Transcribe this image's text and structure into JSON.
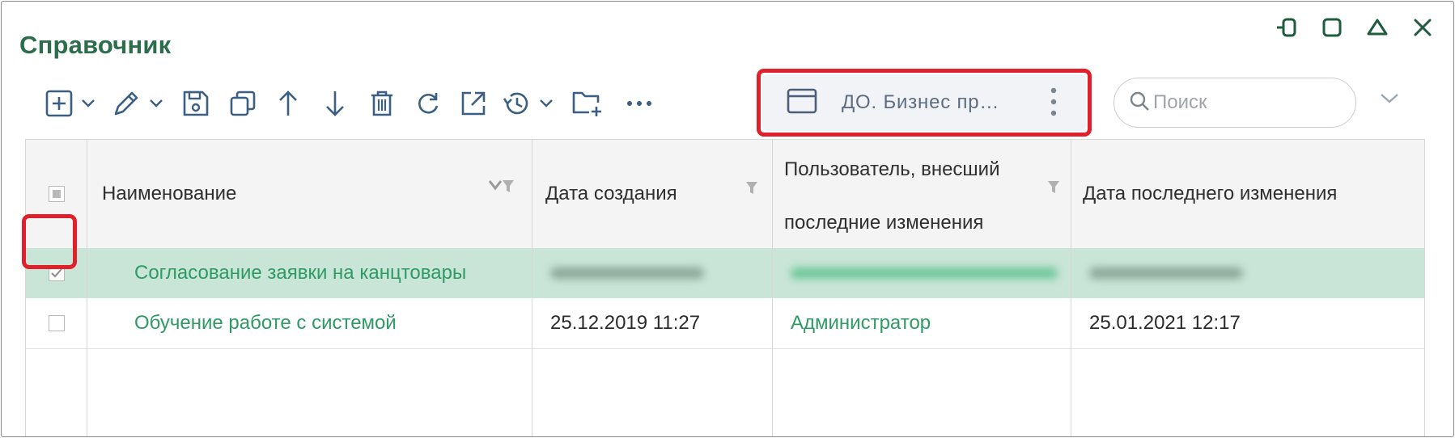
{
  "window": {
    "title": "Справочник"
  },
  "toolbar": {
    "icons": [
      "add-icon",
      "chevron-down-icon",
      "edit-pencil-icon",
      "chevron-down-icon",
      "save-icon",
      "copy-icon",
      "arrow-up-icon",
      "arrow-down-icon",
      "delete-icon",
      "refresh-icon",
      "open-external-icon",
      "history-icon",
      "chevron-down-icon",
      "new-folder-icon",
      "more-horizontal-icon"
    ]
  },
  "view_selector": {
    "label": "ДО. Бизнес пр…"
  },
  "search": {
    "placeholder": "Поиск",
    "value": ""
  },
  "table": {
    "columns": [
      {
        "label": "Наименование"
      },
      {
        "label": "Дата создания"
      },
      {
        "label": "Пользователь, внесший последние изменения"
      },
      {
        "label": "Дата последнего изменения"
      }
    ],
    "rows": [
      {
        "name": "Согласование заявки на канцтовары",
        "created": "",
        "user": "",
        "modified": "",
        "checked": true,
        "selected": true
      },
      {
        "name": "Обучение работе с системой",
        "created": "25.12.2019 11:27",
        "user": "Администратор",
        "modified": "25.01.2021 12:17",
        "checked": false,
        "selected": false
      }
    ]
  },
  "colors": {
    "title": "#2c6e4c",
    "link": "#2e9a64",
    "selected_row": "#c9e5d7",
    "highlight": "#e0202a"
  }
}
